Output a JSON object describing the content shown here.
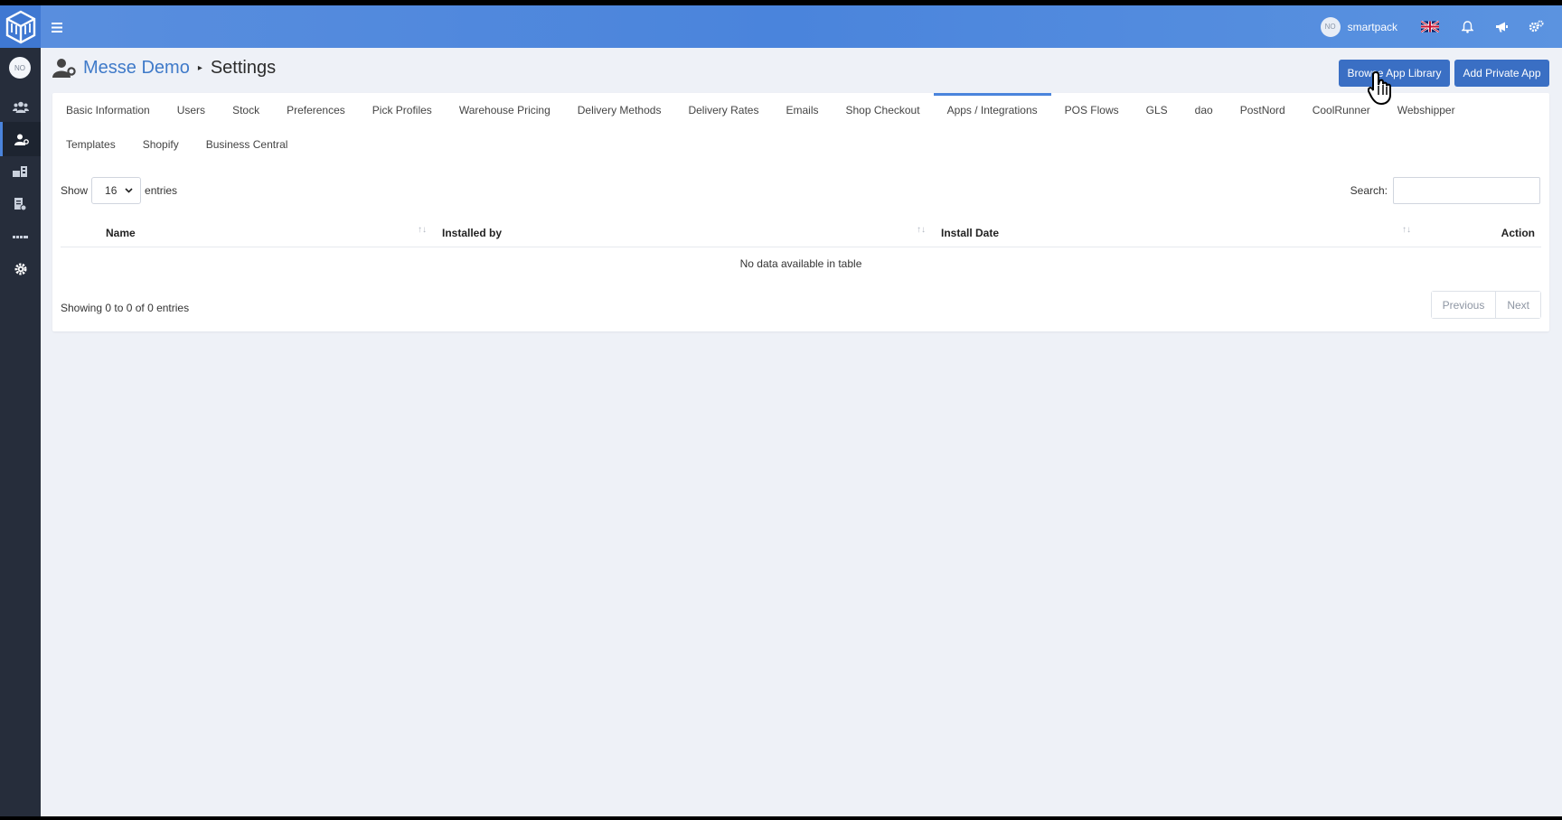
{
  "topbar": {
    "menu_icon": "hamburger-icon",
    "user_avatar_text": "NO",
    "user_name": "smartpack",
    "language_flag": "uk-flag-icon",
    "notifications_icon": "bell-icon",
    "announcements_icon": "megaphone-icon",
    "settings_icon": "gears-icon"
  },
  "sidebar": {
    "avatar_text": "NO",
    "items": [
      {
        "icon": "users-icon"
      },
      {
        "icon": "user-settings-icon",
        "active": true
      },
      {
        "icon": "warehouse-icon"
      },
      {
        "icon": "report-icon"
      },
      {
        "icon": "barcode-icon"
      },
      {
        "icon": "gear-icon"
      }
    ]
  },
  "header": {
    "breadcrumb_link": "Messe Demo",
    "breadcrumb_separator": "▸",
    "breadcrumb_current": "Settings",
    "browse_button": "Browse App Library",
    "add_private_button": "Add Private App"
  },
  "tabs_row1": [
    "Basic Information",
    "Users",
    "Stock",
    "Preferences",
    "Pick Profiles",
    "Warehouse Pricing",
    "Delivery Methods",
    "Delivery Rates",
    "Emails",
    "Shop Checkout",
    "Apps / Integrations",
    "POS Flows",
    "GLS",
    "dao",
    "PostNord",
    "CoolRunner",
    "Webshipper"
  ],
  "tabs_row2": [
    "Templates",
    "Shopify",
    "Business Central"
  ],
  "active_tab": "Apps / Integrations",
  "table": {
    "show_label": "Show",
    "entries_value": "16",
    "entries_label": "entries",
    "search_label": "Search:",
    "search_value": "",
    "columns": [
      "Name",
      "Installed by",
      "Install Date",
      "Action"
    ],
    "empty_message": "No data available in table",
    "info": "Showing 0 to 0 of 0 entries",
    "previous": "Previous",
    "next": "Next"
  }
}
